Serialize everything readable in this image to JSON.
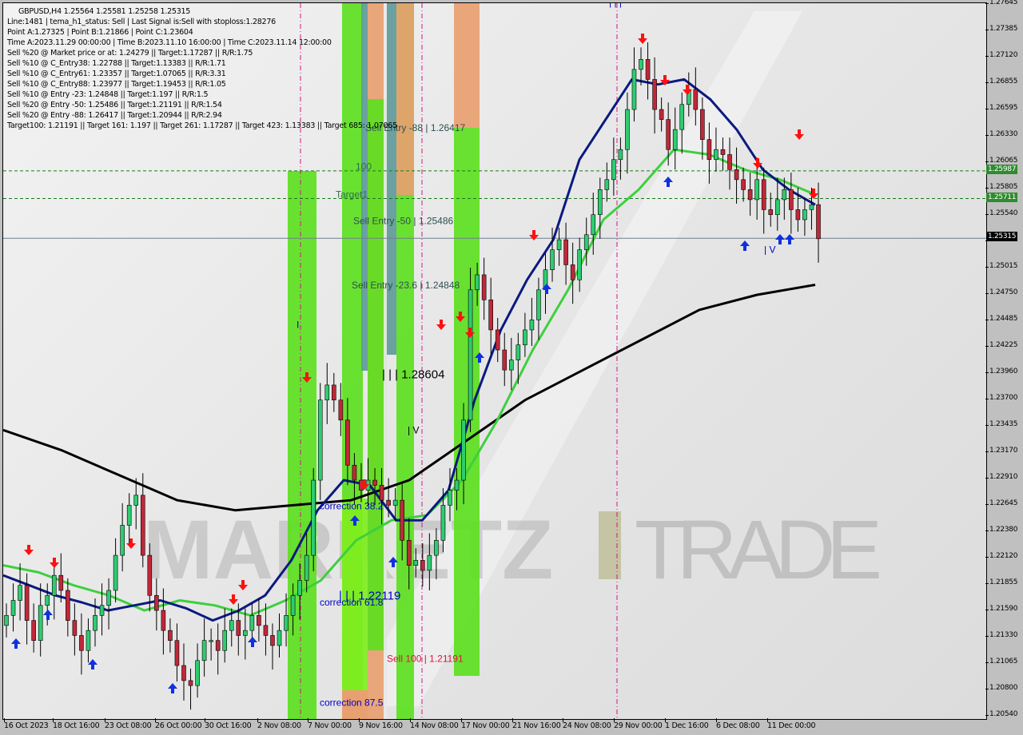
{
  "header": {
    "symbol_line": "GBPUSD,H4  1.25564 1.25581 1.25258 1.25315",
    "lines": [
      "Line:1481 | tema_h1_status: Sell | Last Signal is:Sell with stoploss:1.28276",
      "Point A:1.27325 | Point B:1.21866 | Point C:1.23604",
      "Time A:2023.11.29 00:00:00 | Time B:2023.11.10 16:00:00 | Time C:2023.11.14 12:00:00",
      "Sell %20 @ Market price or at: 1.24279 || Target:1.17287 || R/R:1.75",
      "Sell %10 @ C_Entry38: 1.22788 || Target:1.13383 || R/R:1.71",
      "Sell %10 @ C_Entry61: 1.23357 || Target:1.07065 || R/R:3.31",
      "Sell %10 @ C_Entry88: 1.23977 || Target:1.19453 || R/R:1.05",
      "Sell %10 @ Entry -23: 1.24848 || Target:1.197 || R/R:1.5",
      "Sell %20 @ Entry -50: 1.25486 || Target:1.21191 || R/R:1.54",
      "Sell %20 @ Entry -88: 1.26417 || Target:1.20944 || R/R:2.94",
      "Target100: 1.21191 || Target 161: 1.197 || Target 261: 1.17287 || Target 423: 1.13383 || Target 685: 1.07065"
    ]
  },
  "watermark": {
    "left": "MARKETZ",
    "right": "TRADE"
  },
  "colors": {
    "bull_candle": "#2ecc71",
    "bear_candle": "#c0283a",
    "tema_fast": "#0a1a80",
    "ma_mid": "#3ecf3e",
    "ma_slow": "#000000",
    "zone_green": "#5de020",
    "zone_orange": "#e8a070",
    "zone_teal": "#5f9a9a",
    "vline": "#d01880",
    "level_line": "#1a7a1a",
    "current_price_line": "#708090"
  },
  "chart_data": {
    "type": "candlestick",
    "title": "GBPUSD,H4",
    "ohlc_header": {
      "open": 1.25564,
      "high": 1.25581,
      "low": 1.25258,
      "close": 1.25315
    },
    "ylim": [
      1.2054,
      1.27645
    ],
    "y_ticks": [
      "1.27645",
      "1.27385",
      "1.27120",
      "1.26855",
      "1.26595",
      "1.26330",
      "1.26065",
      "1.25805",
      "1.25540",
      "1.25275",
      "1.25015",
      "1.24750",
      "1.24485",
      "1.24225",
      "1.23960",
      "1.23700",
      "1.23435",
      "1.23170",
      "1.22910",
      "1.22645",
      "1.22380",
      "1.22120",
      "1.21855",
      "1.21590",
      "1.21330",
      "1.21065",
      "1.20800",
      "1.20540"
    ],
    "x_ticks": [
      "16 Oct 2023",
      "18 Oct 16:00",
      "23 Oct 08:00",
      "26 Oct 00:00",
      "30 Oct 16:00",
      "2 Nov 08:00",
      "7 Nov 00:00",
      "9 Nov 16:00",
      "14 Nov 08:00",
      "17 Nov 00:00",
      "21 Nov 16:00",
      "24 Nov 08:00",
      "29 Nov 00:00",
      "1 Dec 16:00",
      "6 Dec 08:00",
      "11 Dec 00:00"
    ],
    "price_labels": [
      {
        "value": "1.25987",
        "kind": "level",
        "color": "#2e8b2e"
      },
      {
        "value": "1.25711",
        "kind": "level",
        "color": "#2e8b2e"
      },
      {
        "value": "1.25315",
        "kind": "current",
        "color": "#000000"
      }
    ],
    "horizontal_levels": [
      {
        "price": 1.25987,
        "style": "dashed",
        "label": "100"
      },
      {
        "price": 1.25711,
        "style": "dashed",
        "label": "Target1"
      },
      {
        "price": 1.25315,
        "style": "solid",
        "label": "current"
      }
    ],
    "annotations": [
      {
        "text": "Sell Entry -88 | 1.26417",
        "price": 1.26417,
        "color": "#2f4f4f"
      },
      {
        "text": "100",
        "price": 1.2603,
        "color": "#2f6f4f"
      },
      {
        "text": "Target1",
        "price": 1.2575,
        "color": "#2f6f4f"
      },
      {
        "text": "Sell Entry -50 | 1.25486",
        "price": 1.25486,
        "color": "#2f4f4f"
      },
      {
        "text": "Sell Entry -23.6 | 1.24848",
        "price": 1.24848,
        "color": "#2f4f4f"
      },
      {
        "text": "| | | 1.28604",
        "price": 1.2395,
        "color": "#000000"
      },
      {
        "text": "correction 38.2",
        "price": 1.2264,
        "color": "#0000cc"
      },
      {
        "text": "| | | 1.22119",
        "price": 1.2174,
        "color": "#0000cc"
      },
      {
        "text": "correction 61.8",
        "price": 1.2168,
        "color": "#0000cc"
      },
      {
        "text": "Sell 100 | 1.21191",
        "price": 1.2112,
        "color": "#dc143c"
      },
      {
        "text": "correction 87.5",
        "price": 1.2068,
        "color": "#0000cc"
      },
      {
        "text": "| | |",
        "price": 1.2767,
        "color": "#0000cc"
      },
      {
        "text": "| V",
        "price": 1.252,
        "color": "#0000cc"
      },
      {
        "text": "| V",
        "price": 1.234,
        "color": "#000000"
      },
      {
        "text": "I",
        "price": 1.2445,
        "color": "#0000cc"
      }
    ],
    "series": [
      {
        "name": "close",
        "values": [
          1.2155,
          1.217,
          1.2185,
          1.215,
          1.213,
          1.2165,
          1.2175,
          1.2195,
          1.218,
          1.215,
          1.2135,
          1.212,
          1.214,
          1.2155,
          1.2165,
          1.218,
          1.2215,
          1.2245,
          1.2265,
          1.2275,
          1.2215,
          1.2175,
          1.216,
          1.214,
          1.213,
          1.2105,
          1.209,
          1.2085,
          1.211,
          1.213,
          1.213,
          1.212,
          1.214,
          1.215,
          1.2135,
          1.214,
          1.2155,
          1.2145,
          1.2135,
          1.2125,
          1.214,
          1.2155,
          1.2175,
          1.219,
          1.2215,
          1.229,
          1.237,
          1.2385,
          1.237,
          1.235,
          1.2305,
          1.229,
          1.228,
          1.229,
          1.2285,
          1.227,
          1.2265,
          1.227,
          1.223,
          1.2205,
          1.221,
          1.22,
          1.2215,
          1.223,
          1.2265,
          1.228,
          1.229,
          1.235,
          1.248,
          1.2495,
          1.247,
          1.244,
          1.242,
          1.24,
          1.241,
          1.2425,
          1.244,
          1.245,
          1.248,
          1.25,
          1.252,
          1.253,
          1.2505,
          1.249,
          1.252,
          1.2535,
          1.2555,
          1.258,
          1.259,
          1.261,
          1.262,
          1.266,
          1.27,
          1.271,
          1.269,
          1.266,
          1.265,
          1.262,
          1.264,
          1.2665,
          1.268,
          1.266,
          1.263,
          1.261,
          1.262,
          1.2615,
          1.26,
          1.259,
          1.258,
          1.257,
          1.259,
          1.256,
          1.2555,
          1.257,
          1.258,
          1.256,
          1.255,
          1.256,
          1.2565,
          1.2531
        ]
      },
      {
        "name": "TEMA (dark blue)",
        "values": [
          1.2195,
          1.2185,
          1.2175,
          1.2168,
          1.216,
          1.2165,
          1.217,
          1.2162,
          1.215,
          1.216,
          1.2175,
          1.221,
          1.226,
          1.229,
          1.2285,
          1.225,
          1.225,
          1.228,
          1.237,
          1.244,
          1.249,
          1.253,
          1.261,
          1.265,
          1.269,
          1.2685,
          1.269,
          1.267,
          1.264,
          1.26,
          1.258,
          1.2565
        ]
      },
      {
        "name": "MA mid (green)",
        "values": [
          1.2205,
          1.2198,
          1.2185,
          1.2175,
          1.216,
          1.217,
          1.2165,
          1.2155,
          1.217,
          1.219,
          1.223,
          1.225,
          1.2255,
          1.229,
          1.235,
          1.242,
          1.248,
          1.255,
          1.258,
          1.262,
          1.2615,
          1.26,
          1.259,
          1.2575
        ]
      },
      {
        "name": "MA slow (black)",
        "values": [
          1.234,
          1.232,
          1.2295,
          1.227,
          1.226,
          1.2265,
          1.227,
          1.229,
          1.233,
          1.237,
          1.24,
          1.243,
          1.246,
          1.2475,
          1.2485
        ]
      }
    ]
  }
}
